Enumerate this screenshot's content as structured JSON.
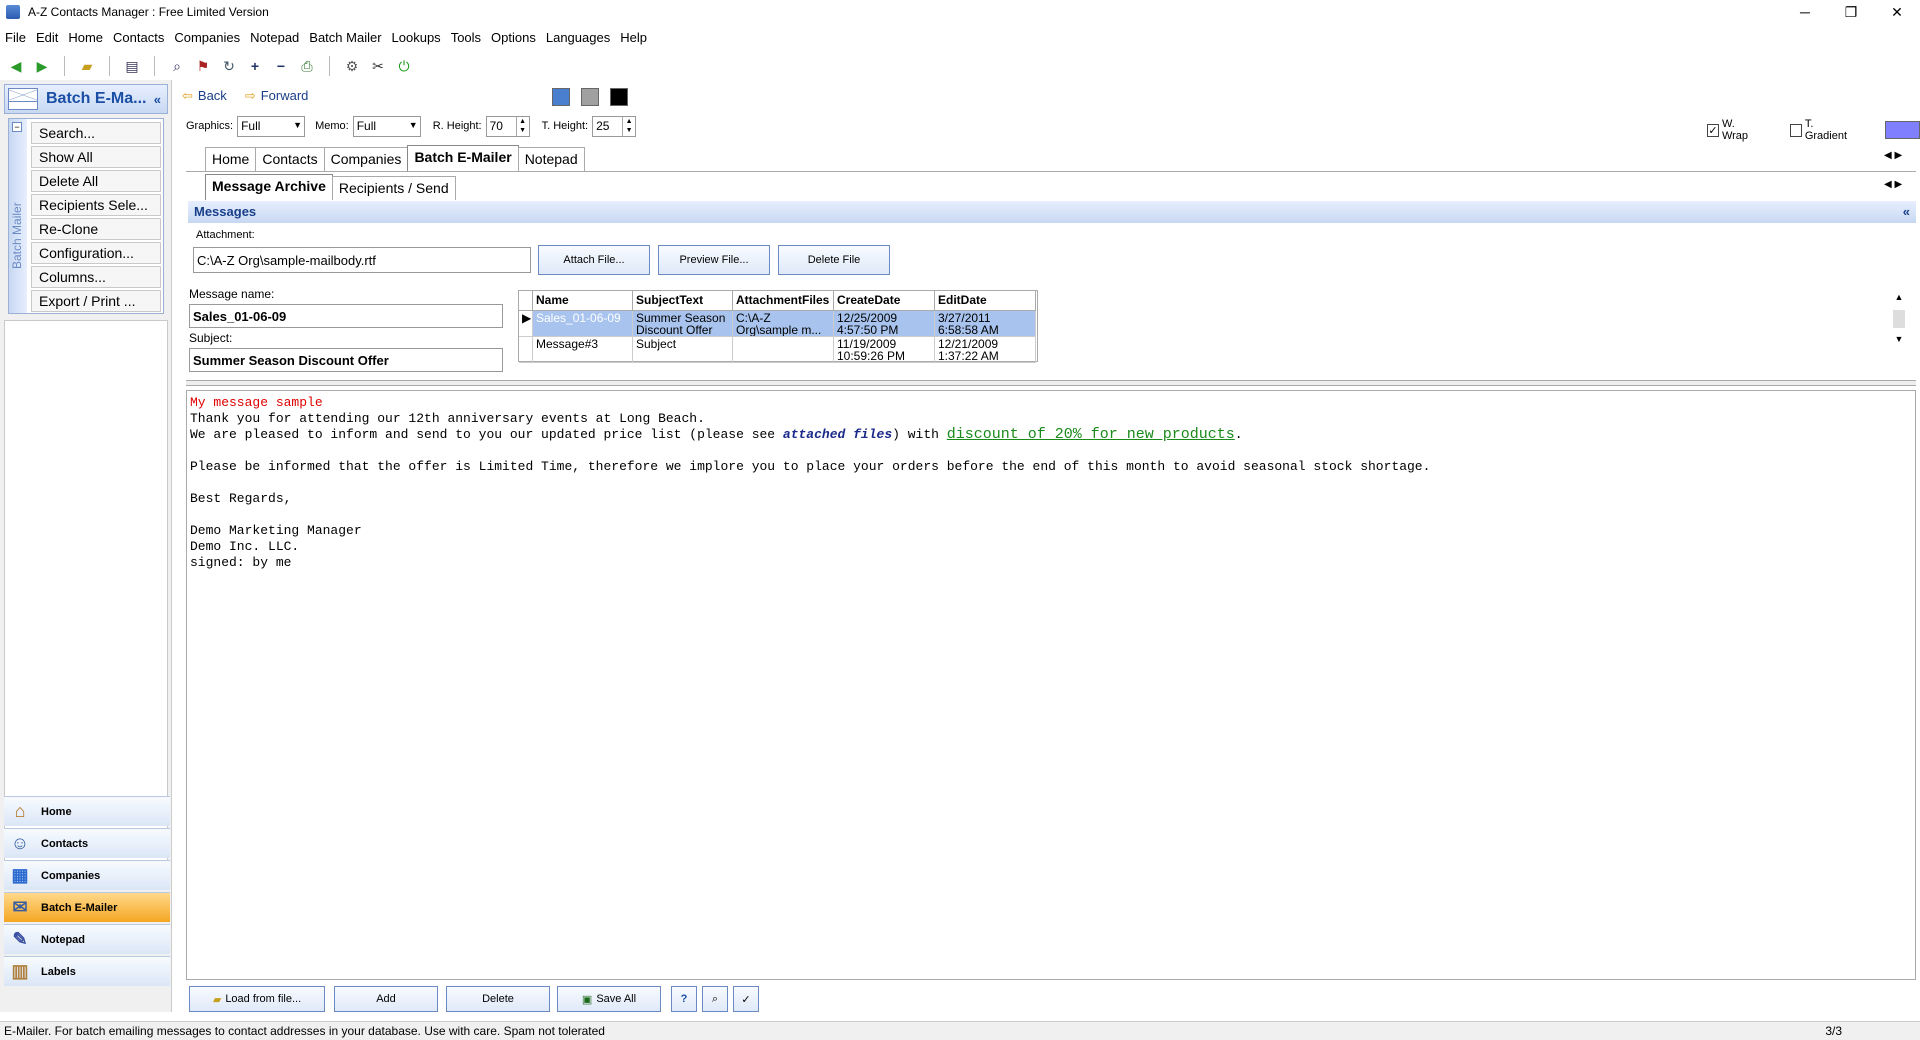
{
  "window": {
    "title": "A-Z Contacts Manager : Free Limited Version"
  },
  "menu": [
    "File",
    "Edit",
    "Home",
    "Contacts",
    "Companies",
    "Notepad",
    "Batch Mailer",
    "Lookups",
    "Tools",
    "Options",
    "Languages",
    "Help"
  ],
  "left_panel": {
    "header_title": "Batch E-Ma...",
    "strip_label": "Batch Mailer",
    "buttons": [
      "Search...",
      "Show All",
      "Delete All",
      "Recipients Sele...",
      "Re-Clone",
      "Configuration...",
      "Columns...",
      "Export / Print ..."
    ],
    "nav": [
      "Home",
      "Contacts",
      "Companies",
      "Batch E-Mailer",
      "Notepad",
      "Labels"
    ]
  },
  "navbar": {
    "back": "Back",
    "forward": "Forward"
  },
  "swatches": [
    "#4a7fd0",
    "#a0a0a0",
    "#000000"
  ],
  "options": {
    "graphics_label": "Graphics:",
    "graphics_value": "Full",
    "memo_label": "Memo:",
    "memo_value": "Full",
    "rheight_label": "R. Height:",
    "rheight_value": "70",
    "theight_label": "T. Height:",
    "theight_value": "25",
    "wwrap_label": "W. Wrap",
    "tgradient_label": "T. Gradient"
  },
  "main_tabs": [
    "Home",
    "Contacts",
    "Companies",
    "Batch E-Mailer",
    "Notepad"
  ],
  "sub_tabs": [
    "Message Archive",
    "Recipients / Send"
  ],
  "messages": {
    "section_title": "Messages",
    "attachment_label": "Attachment:",
    "attachment_value": "C:\\A-Z Org\\sample-mailbody.rtf",
    "attach_btn": "Attach File...",
    "preview_btn": "Preview File...",
    "delete_file_btn": "Delete File",
    "message_name_label": "Message name:",
    "message_name_value": "Sales_01-06-09",
    "subject_label": "Subject:",
    "subject_value": "Summer Season Discount Offer"
  },
  "grid": {
    "columns": [
      "Name",
      "SubjectText",
      "AttachmentFiles",
      "CreateDate",
      "EditDate"
    ],
    "rows": [
      [
        "Sales_01-06-09",
        "Summer Season Discount Offer",
        "C:\\A-Z Org\\sample m...",
        "12/25/2009 4:57:50 PM",
        "3/27/2011 6:58:58 AM"
      ],
      [
        "Message#3",
        "Subject",
        "",
        "11/19/2009 10:59:26 PM",
        "12/21/2009 1:37:22 AM"
      ]
    ]
  },
  "editor": {
    "line1": "My message sample",
    "line2": "Thank you for attending our 12th anniversary events at Long Beach.",
    "line3a": "We are pleased to inform and send to you our updated price list (please see ",
    "line3b": "attached files",
    "line3c": ") with ",
    "line3d": "discount of 20% for new products",
    "line3e": ".",
    "line5": "Please be informed that the offer is Limited Time, therefore we implore you to place your orders before the end of this month to avoid seasonal stock shortage.",
    "line7": "Best Regards,",
    "line9": "Demo Marketing Manager",
    "line10": "Demo Inc. LLC.",
    "line11": "signed: by me"
  },
  "bottom_buttons": {
    "load": "Load from file...",
    "add": "Add",
    "delete": "Delete",
    "save_all": "Save All"
  },
  "status": {
    "text": "E-Mailer. For batch emailing messages to contact addresses in your database. Use with care. Spam not tolerated",
    "page": "3/3"
  }
}
